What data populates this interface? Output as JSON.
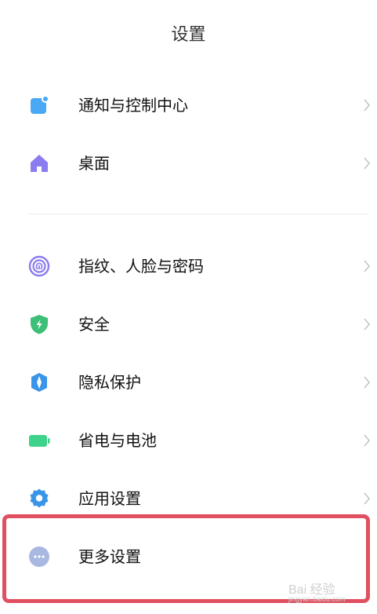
{
  "header": {
    "title": "设置"
  },
  "items": [
    {
      "label": "通知与控制中心",
      "icon": "notification-icon",
      "color": "#4aa8f5"
    },
    {
      "label": "桌面",
      "icon": "home-icon",
      "color": "#8b7cf0"
    },
    {
      "label": "指纹、人脸与密码",
      "icon": "fingerprint-icon",
      "color": "#8b7cf0"
    },
    {
      "label": "安全",
      "icon": "security-shield-icon",
      "color": "#3dbf77"
    },
    {
      "label": "隐私保护",
      "icon": "privacy-icon",
      "color": "#3a95e8"
    },
    {
      "label": "省电与电池",
      "icon": "battery-icon",
      "color": "#3ed38a"
    },
    {
      "label": "应用设置",
      "icon": "gear-icon",
      "color": "#3a95e8"
    },
    {
      "label": "更多设置",
      "icon": "more-dots-icon",
      "color": "#a8b8e0"
    }
  ],
  "watermark": {
    "text": "Bai 经验",
    "sub": "jingyan.baidu.com"
  },
  "highlight_color": "#e05060"
}
